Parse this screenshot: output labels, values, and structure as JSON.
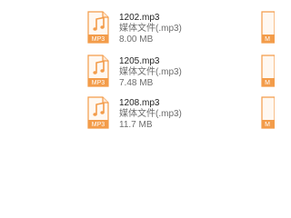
{
  "files": [
    {
      "name": "1202.mp3",
      "type": "媒体文件(.mp3)",
      "size": "8.00 MB",
      "icon": "audio-file-icon",
      "badge": "MP3"
    },
    {
      "name": "1205.mp3",
      "type": "媒体文件(.mp3)",
      "size": "7.48 MB",
      "icon": "audio-file-icon",
      "badge": "MP3"
    },
    {
      "name": "1208.mp3",
      "type": "媒体文件(.mp3)",
      "size": "11.7 MB",
      "icon": "audio-file-icon",
      "badge": "MP3"
    }
  ],
  "right_partial_badge": "M",
  "colors": {
    "icon_orange": "#f39c4a",
    "icon_body": "#fff8f1",
    "text_primary": "#1f1f1f",
    "text_secondary": "#6d6d6d"
  }
}
